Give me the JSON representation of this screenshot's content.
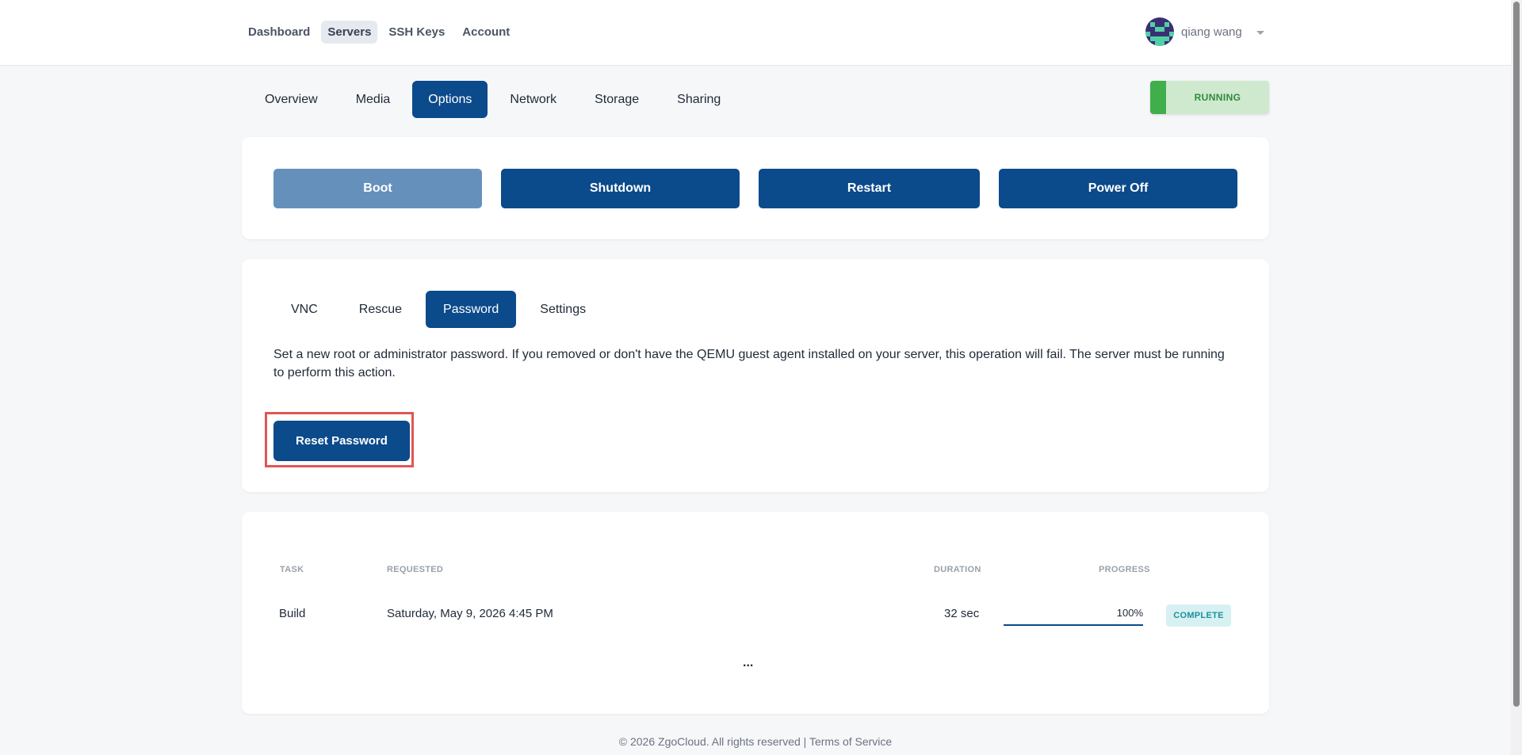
{
  "nav": {
    "items": [
      "Dashboard",
      "Servers",
      "SSH Keys",
      "Account"
    ],
    "active": "Servers"
  },
  "user": {
    "name": "qiang wang"
  },
  "tabs": {
    "items": [
      "Overview",
      "Media",
      "Options",
      "Network",
      "Storage",
      "Sharing"
    ],
    "active": "Options"
  },
  "status": {
    "label": "RUNNING",
    "color": "#3fae4b"
  },
  "power": {
    "boot": "Boot",
    "shutdown": "Shutdown",
    "restart": "Restart",
    "power_off": "Power Off"
  },
  "options_tabs": {
    "items": [
      "VNC",
      "Rescue",
      "Password",
      "Settings"
    ],
    "active": "Password"
  },
  "password": {
    "description": "Set a new root or administrator password. If you removed or don't have the QEMU guest agent installed on your server, this operation will fail. The server must be running to perform this action.",
    "reset_label": "Reset Password"
  },
  "tasks": {
    "headers": {
      "task": "TASK",
      "requested": "REQUESTED",
      "duration": "DURATION",
      "progress": "PROGRESS"
    },
    "rows": [
      {
        "task": "Build",
        "requested": "Saturday, May 9, 2026 4:45 PM",
        "duration": "32 sec",
        "progress": "100%",
        "progress_value": 1.0,
        "status": "COMPLETE"
      }
    ],
    "more": "..."
  },
  "footer": {
    "copyright": "© 2026 ZgoCloud. All rights reserved |",
    "terms": "Terms of Service"
  },
  "colors": {
    "primary": "#0b4a8b",
    "running": "#3fae4b",
    "complete": "#1c8f9c"
  }
}
